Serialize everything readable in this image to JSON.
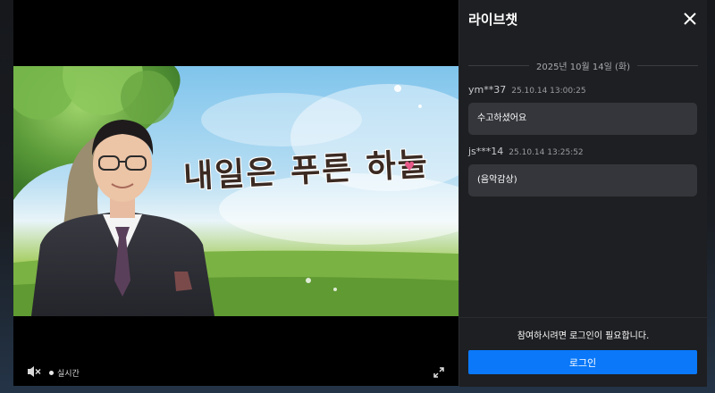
{
  "player": {
    "program_title": "내일은 푸른 하늘",
    "live_label": "실시간",
    "icons": {
      "mute": "speaker-muted-icon",
      "live": "dot-icon",
      "fullscreen": "expand-icon",
      "heart": "heart-icon"
    }
  },
  "chat": {
    "title": "라이브챗",
    "close_icon": "close-icon",
    "date": "2025년 10월 14일 (화)",
    "messages": [
      {
        "user": "ym**37",
        "time": "25.10.14 13:00:25",
        "text": "수고하셨어요"
      },
      {
        "user": "js***14",
        "time": "25.10.14 13:25:52",
        "text": "(음악감상)"
      }
    ],
    "login_notice": "참여하시려면 로그인이 필요합니다.",
    "login_button": "로그인"
  },
  "colors": {
    "accent": "#0a78f8",
    "panel": "#1e1f22",
    "bubble": "#34363b"
  }
}
